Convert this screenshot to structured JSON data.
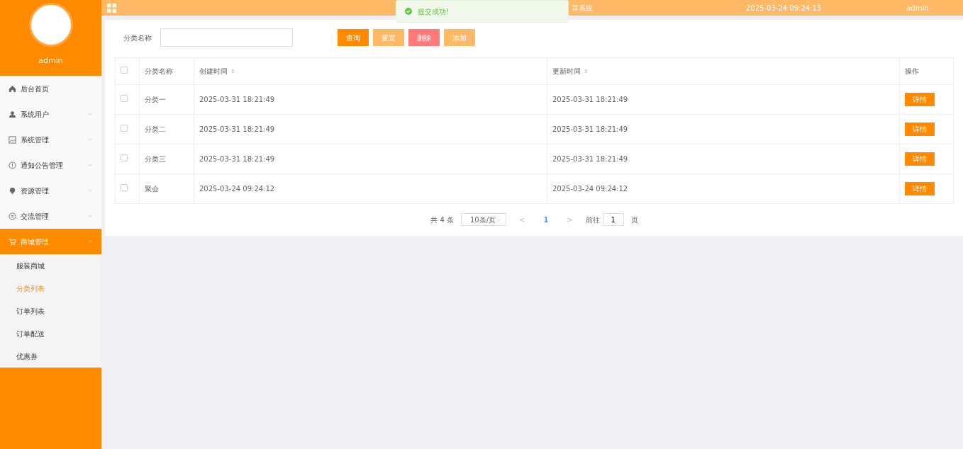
{
  "sidebar": {
    "user": "admin",
    "menu": [
      {
        "label": "后台首页",
        "expandable": false,
        "selected": false
      },
      {
        "label": "系统用户",
        "expandable": true,
        "expanded": false,
        "selected": false
      },
      {
        "label": "系统管理",
        "expandable": true,
        "expanded": false,
        "selected": false
      },
      {
        "label": "通知公告管理",
        "expandable": true,
        "expanded": false,
        "selected": false
      },
      {
        "label": "资源管理",
        "expandable": true,
        "expanded": false,
        "selected": false
      },
      {
        "label": "交流管理",
        "expandable": true,
        "expanded": false,
        "selected": false
      },
      {
        "label": "商城管理",
        "expandable": true,
        "expanded": true,
        "selected": true,
        "children": [
          {
            "label": "服装商城",
            "selected": false
          },
          {
            "label": "分类列表",
            "selected": true
          },
          {
            "label": "订单列表",
            "selected": false
          },
          {
            "label": "订单配送",
            "selected": false
          },
          {
            "label": "优惠券",
            "selected": false
          }
        ]
      }
    ]
  },
  "header": {
    "title": "荐系统",
    "datetime": "2025-03-24 09:24:13",
    "user": "admin"
  },
  "toast": {
    "message": "提交成功!"
  },
  "search": {
    "label": "分类名称",
    "buttons": [
      {
        "label": "查询",
        "kind": "primary"
      },
      {
        "label": "重置",
        "kind": "light"
      },
      {
        "label": "删除",
        "kind": "danger"
      },
      {
        "label": "添加",
        "kind": "light"
      }
    ]
  },
  "table": {
    "select_all": false,
    "columns": [
      {
        "label": "分类名称",
        "sortable": false
      },
      {
        "label": "创建时间",
        "sortable": true
      },
      {
        "label": "更新时间",
        "sortable": true
      },
      {
        "label": "操作",
        "sortable": false
      }
    ],
    "rows": [
      {
        "checked": false,
        "cells": [
          "分类一",
          "2025-03-31 18:21:49",
          "2025-03-31 18:21:49"
        ],
        "action": "详情"
      },
      {
        "checked": false,
        "cells": [
          "分类二",
          "2025-03-31 18:21:49",
          "2025-03-31 18:21:49"
        ],
        "action": "详情"
      },
      {
        "checked": false,
        "cells": [
          "分类三",
          "2025-03-31 18:21:49",
          "2025-03-31 18:21:49"
        ],
        "action": "详情"
      },
      {
        "checked": false,
        "cells": [
          "聚会",
          "2025-03-24 09:24:12",
          "2025-03-24 09:24:12"
        ],
        "action": "详情"
      }
    ]
  },
  "pagination": {
    "total": "共 4 条",
    "page_size": "10条/页",
    "prev": "<",
    "pages": [
      {
        "label": "1",
        "selected": true
      }
    ],
    "next": ">",
    "goto_label": "前往",
    "goto_value": "1",
    "goto_suffix": "页"
  }
}
